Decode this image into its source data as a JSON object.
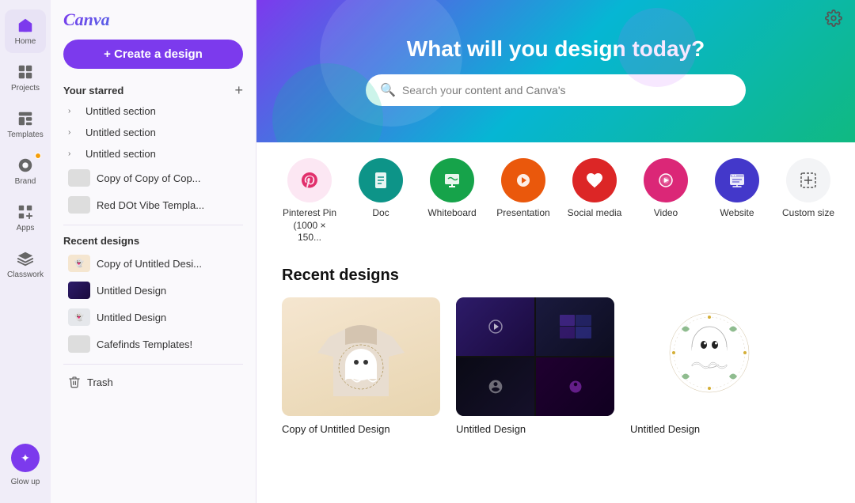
{
  "app": {
    "logo": "Canva",
    "settings_icon": "⚙"
  },
  "icon_nav": {
    "items": [
      {
        "id": "home",
        "label": "Home",
        "icon": "🏠",
        "active": true
      },
      {
        "id": "projects",
        "label": "Projects",
        "icon": "🗂"
      },
      {
        "id": "templates",
        "label": "Templates",
        "icon": "📐"
      },
      {
        "id": "brand",
        "label": "Brand",
        "icon": "🎨",
        "badge": true
      },
      {
        "id": "apps",
        "label": "Apps",
        "icon": "⊞"
      },
      {
        "id": "classwork",
        "label": "Classwork",
        "icon": "🎓"
      }
    ],
    "bottom": {
      "label": "Glow up",
      "icon": "✦"
    }
  },
  "sidebar": {
    "create_button": "+ Create a design",
    "starred_section": {
      "label": "Your starred",
      "plus_icon": "+"
    },
    "untitled_sections": [
      "Untitled section",
      "Untitled section",
      "Untitled section"
    ],
    "starred_items": [
      {
        "label": "Copy of Copy of Cop..."
      },
      {
        "label": "Red DOt Vibe Templa..."
      }
    ],
    "recent_label": "Recent designs",
    "recent_items": [
      {
        "label": "Copy of Untitled Desi..."
      },
      {
        "label": "Untitled Design"
      },
      {
        "label": "Untitled Design"
      },
      {
        "label": "Cafefinds Templates!"
      }
    ],
    "trash_label": "Trash"
  },
  "hero": {
    "title": "What will you design today?",
    "search_placeholder": "Search your content and Canva's"
  },
  "quick_actions": [
    {
      "id": "pinterest",
      "label": "Pinterest Pin\n(1000 × 150...",
      "color": "qa-pink",
      "icon": "📌"
    },
    {
      "id": "doc",
      "label": "Doc",
      "color": "qa-teal",
      "icon": "📄"
    },
    {
      "id": "whiteboard",
      "label": "Whiteboard",
      "color": "qa-green",
      "icon": "🖊"
    },
    {
      "id": "presentation",
      "label": "Presentation",
      "color": "qa-orange",
      "icon": "🎭"
    },
    {
      "id": "social",
      "label": "Social media",
      "color": "qa-red",
      "icon": "❤"
    },
    {
      "id": "video",
      "label": "Video",
      "color": "qa-pink2",
      "icon": "▶"
    },
    {
      "id": "website",
      "label": "Website",
      "color": "qa-indigo",
      "icon": "🖥"
    },
    {
      "id": "custom",
      "label": "Custom size",
      "color": "qa-gray",
      "icon": "⊡"
    }
  ],
  "recent_designs": {
    "title": "Recent designs",
    "items": [
      {
        "id": "card1",
        "title": "Copy of Untitled Design",
        "type": "sweatshirt"
      },
      {
        "id": "card2",
        "title": "Untitled Design",
        "type": "video-grid"
      },
      {
        "id": "card3",
        "title": "Untitled Design",
        "type": "ghost"
      }
    ]
  }
}
